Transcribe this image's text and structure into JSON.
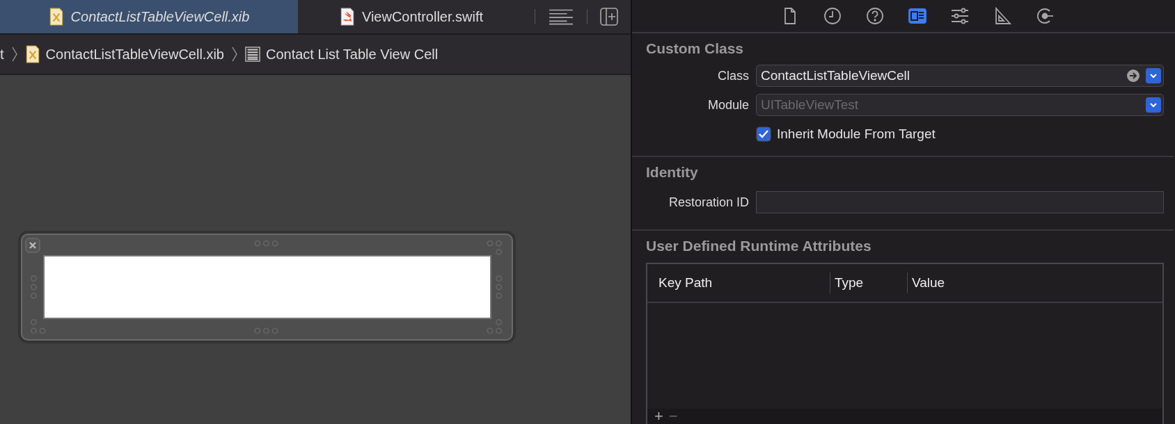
{
  "editor_tabs": [
    {
      "label": "ContactListTableViewCell.xib",
      "kind": "xib",
      "selected": true
    },
    {
      "label": "ViewController.swift",
      "kind": "swift",
      "selected": false
    }
  ],
  "breadcrumb": [
    {
      "label": "t",
      "kind": "none"
    },
    {
      "label": "ContactListTableViewCell.xib",
      "kind": "xib"
    },
    {
      "label": "Contact List Table View Cell",
      "kind": "cell"
    }
  ],
  "inspector_tabs": [
    {
      "kind": "file",
      "selected": false
    },
    {
      "kind": "history",
      "selected": false
    },
    {
      "kind": "help",
      "selected": false
    },
    {
      "kind": "identity",
      "selected": true
    },
    {
      "kind": "attributes",
      "selected": false
    },
    {
      "kind": "size",
      "selected": false
    },
    {
      "kind": "connections",
      "selected": false
    }
  ],
  "custom_class": {
    "title": "Custom Class",
    "class_field": {
      "label": "Class",
      "value": "ContactListTableViewCell",
      "disabled": false
    },
    "module_field": {
      "label": "Module",
      "value": "UITableViewTest",
      "disabled": true
    },
    "inherit": {
      "label": "Inherit Module From Target",
      "checked": true
    }
  },
  "identity": {
    "title": "Identity",
    "restoration_label": "Restoration ID"
  },
  "runtime_attributes": {
    "title": "User Defined Runtime Attributes",
    "columns": [
      "Key Path",
      "Type",
      "Value"
    ],
    "add": "+",
    "remove": "−"
  }
}
